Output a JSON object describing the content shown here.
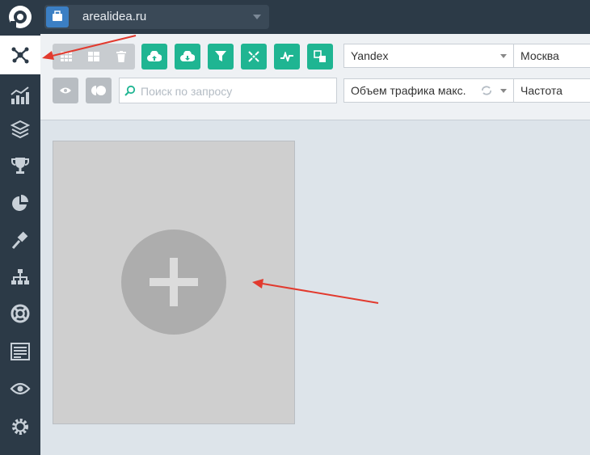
{
  "project": {
    "name": "arealidea.ru"
  },
  "sidebar": {
    "items": [
      {
        "icon": "network-icon",
        "active": true
      },
      {
        "icon": "chart-icon"
      },
      {
        "icon": "layers-icon"
      },
      {
        "icon": "trophy-icon"
      },
      {
        "icon": "pie-chart-icon"
      },
      {
        "icon": "gavel-icon"
      },
      {
        "icon": "sitemap-icon"
      },
      {
        "icon": "lifebuoy-icon"
      },
      {
        "icon": "report-icon"
      },
      {
        "icon": "eye-icon"
      },
      {
        "icon": "settings-icon"
      }
    ]
  },
  "toolbar": {
    "search_engine": "Yandex",
    "region": "Москва",
    "search_placeholder": "Поиск по запросу",
    "traffic_mode": "Объем трафика макс.",
    "metric": "Частота"
  },
  "colors": {
    "accent_green": "#1fb592",
    "sidebar_bg": "#2c3a47",
    "annotation_red": "#e23a2e"
  }
}
